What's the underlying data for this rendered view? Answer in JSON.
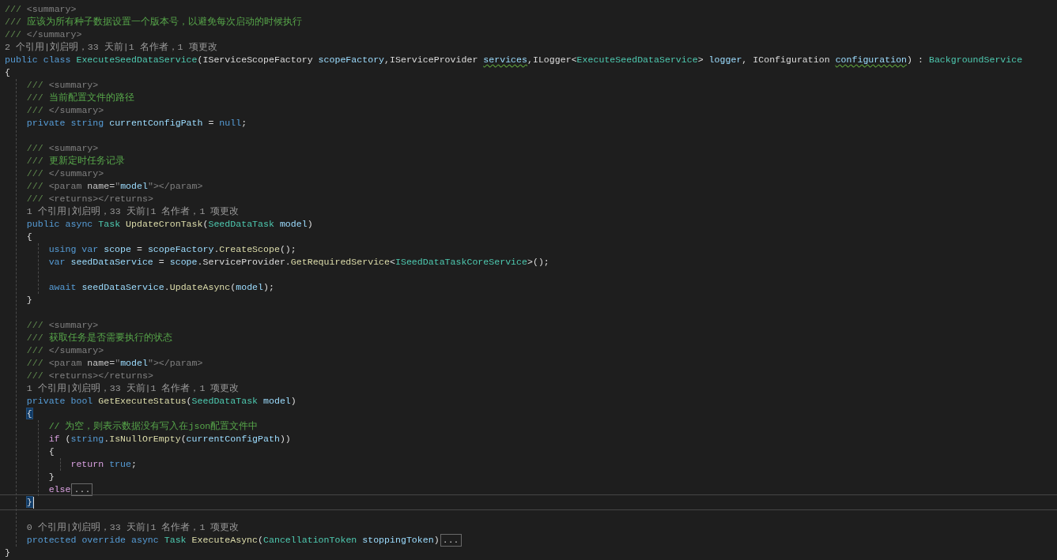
{
  "editor": {
    "lines": [
      {
        "kind": "code",
        "tokens": [
          {
            "text": "/// ",
            "kind": "doc-delim"
          },
          {
            "text": "<summary>",
            "kind": "doc-tag"
          }
        ]
      },
      {
        "kind": "code",
        "tokens": [
          {
            "text": "/// ",
            "kind": "doc-delim"
          },
          {
            "text": "应该为所有种子数据设置一个版本号，以避免每次启动的时候执行",
            "kind": "comment"
          }
        ]
      },
      {
        "kind": "code",
        "tokens": [
          {
            "text": "/// ",
            "kind": "doc-delim"
          },
          {
            "text": "</summary>",
            "kind": "doc-tag"
          }
        ]
      },
      {
        "kind": "codelens",
        "text": "2 个引用|刘启明，33 天前|1 名作者，1 项更改"
      },
      {
        "kind": "code",
        "tokens": [
          {
            "text": "public class ",
            "kind": "keyword"
          },
          {
            "text": "ExecuteSeedDataService",
            "kind": "type"
          },
          {
            "text": "(IServiceScopeFactory ",
            "kind": "plain"
          },
          {
            "text": "scopeFactory",
            "kind": "variable"
          },
          {
            "text": ",IServiceProvider ",
            "kind": "plain"
          },
          {
            "text": "services",
            "kind": "variable-warning"
          },
          {
            "text": ",ILogger<",
            "kind": "plain"
          },
          {
            "text": "ExecuteSeedDataService",
            "kind": "type"
          },
          {
            "text": "> ",
            "kind": "plain"
          },
          {
            "text": "logger",
            "kind": "variable"
          },
          {
            "text": ", IConfiguration ",
            "kind": "plain"
          },
          {
            "text": "configuration",
            "kind": "variable-warning"
          },
          {
            "text": ") : ",
            "kind": "plain"
          },
          {
            "text": "BackgroundService",
            "kind": "type"
          }
        ]
      },
      {
        "kind": "code",
        "tokens": [
          {
            "text": "{",
            "kind": "plain"
          }
        ]
      },
      {
        "kind": "block",
        "children": [
          {
            "kind": "code",
            "tokens": [
              {
                "text": "/// ",
                "kind": "doc-delim"
              },
              {
                "text": "<summary>",
                "kind": "doc-tag"
              }
            ]
          },
          {
            "kind": "code",
            "tokens": [
              {
                "text": "/// ",
                "kind": "doc-delim"
              },
              {
                "text": "当前配置文件的路径",
                "kind": "comment"
              }
            ]
          },
          {
            "kind": "code",
            "tokens": [
              {
                "text": "/// ",
                "kind": "doc-delim"
              },
              {
                "text": "</summary>",
                "kind": "doc-tag"
              }
            ]
          },
          {
            "kind": "code",
            "tokens": [
              {
                "text": "private string ",
                "kind": "keyword"
              },
              {
                "text": "currentConfigPath",
                "kind": "variable"
              },
              {
                "text": " = ",
                "kind": "plain"
              },
              {
                "text": "null",
                "kind": "keyword"
              },
              {
                "text": ";",
                "kind": "plain"
              }
            ]
          },
          {
            "kind": "blank"
          },
          {
            "kind": "code",
            "tokens": [
              {
                "text": "/// ",
                "kind": "doc-delim"
              },
              {
                "text": "<summary>",
                "kind": "doc-tag"
              }
            ]
          },
          {
            "kind": "code",
            "tokens": [
              {
                "text": "/// ",
                "kind": "doc-delim"
              },
              {
                "text": "更新定时任务记录",
                "kind": "comment"
              }
            ]
          },
          {
            "kind": "code",
            "tokens": [
              {
                "text": "/// ",
                "kind": "doc-delim"
              },
              {
                "text": "</summary>",
                "kind": "doc-tag"
              }
            ]
          },
          {
            "kind": "code",
            "tokens": [
              {
                "text": "/// ",
                "kind": "doc-delim"
              },
              {
                "text": "<param ",
                "kind": "doc-tag"
              },
              {
                "text": "name=",
                "kind": "attr"
              },
              {
                "text": "\"",
                "kind": "doc-tag"
              },
              {
                "text": "model",
                "kind": "variable"
              },
              {
                "text": "\"></param>",
                "kind": "doc-tag"
              }
            ]
          },
          {
            "kind": "code",
            "tokens": [
              {
                "text": "/// ",
                "kind": "doc-delim"
              },
              {
                "text": "<returns></returns>",
                "kind": "doc-tag"
              }
            ]
          },
          {
            "kind": "codelens",
            "text": "1 个引用|刘启明，33 天前|1 名作者，1 项更改"
          },
          {
            "kind": "code",
            "tokens": [
              {
                "text": "public async ",
                "kind": "keyword"
              },
              {
                "text": "Task ",
                "kind": "type"
              },
              {
                "text": "UpdateCronTask",
                "kind": "method"
              },
              {
                "text": "(",
                "kind": "plain"
              },
              {
                "text": "SeedDataTask ",
                "kind": "type"
              },
              {
                "text": "model",
                "kind": "variable"
              },
              {
                "text": ")",
                "kind": "plain"
              }
            ]
          },
          {
            "kind": "code",
            "tokens": [
              {
                "text": "{",
                "kind": "plain"
              }
            ]
          },
          {
            "kind": "block",
            "children": [
              {
                "kind": "code",
                "tokens": [
                  {
                    "text": "using var ",
                    "kind": "keyword"
                  },
                  {
                    "text": "scope",
                    "kind": "variable"
                  },
                  {
                    "text": " = ",
                    "kind": "plain"
                  },
                  {
                    "text": "scopeFactory",
                    "kind": "variable"
                  },
                  {
                    "text": ".",
                    "kind": "plain"
                  },
                  {
                    "text": "CreateScope",
                    "kind": "method"
                  },
                  {
                    "text": "();",
                    "kind": "plain"
                  }
                ]
              },
              {
                "kind": "code",
                "tokens": [
                  {
                    "text": "var ",
                    "kind": "keyword"
                  },
                  {
                    "text": "seedDataService",
                    "kind": "variable"
                  },
                  {
                    "text": " = ",
                    "kind": "plain"
                  },
                  {
                    "text": "scope",
                    "kind": "variable"
                  },
                  {
                    "text": ".ServiceProvider.",
                    "kind": "plain"
                  },
                  {
                    "text": "GetRequiredService",
                    "kind": "method"
                  },
                  {
                    "text": "<",
                    "kind": "plain"
                  },
                  {
                    "text": "ISeedDataTaskCoreService",
                    "kind": "type"
                  },
                  {
                    "text": ">();",
                    "kind": "plain"
                  }
                ]
              },
              {
                "kind": "blank"
              },
              {
                "kind": "code",
                "tokens": [
                  {
                    "text": "await ",
                    "kind": "keyword"
                  },
                  {
                    "text": "seedDataService",
                    "kind": "variable"
                  },
                  {
                    "text": ".",
                    "kind": "plain"
                  },
                  {
                    "text": "UpdateAsync",
                    "kind": "method"
                  },
                  {
                    "text": "(",
                    "kind": "plain"
                  },
                  {
                    "text": "model",
                    "kind": "variable"
                  },
                  {
                    "text": ");",
                    "kind": "plain"
                  }
                ]
              }
            ]
          },
          {
            "kind": "code",
            "tokens": [
              {
                "text": "}",
                "kind": "plain"
              }
            ]
          },
          {
            "kind": "blank"
          },
          {
            "kind": "code",
            "tokens": [
              {
                "text": "/// ",
                "kind": "doc-delim"
              },
              {
                "text": "<summary>",
                "kind": "doc-tag"
              }
            ]
          },
          {
            "kind": "code",
            "tokens": [
              {
                "text": "/// ",
                "kind": "doc-delim"
              },
              {
                "text": "获取任务是否需要执行的状态",
                "kind": "comment"
              }
            ]
          },
          {
            "kind": "code",
            "tokens": [
              {
                "text": "/// ",
                "kind": "doc-delim"
              },
              {
                "text": "</summary>",
                "kind": "doc-tag"
              }
            ]
          },
          {
            "kind": "code",
            "tokens": [
              {
                "text": "/// ",
                "kind": "doc-delim"
              },
              {
                "text": "<param ",
                "kind": "doc-tag"
              },
              {
                "text": "name=",
                "kind": "attr"
              },
              {
                "text": "\"",
                "kind": "doc-tag"
              },
              {
                "text": "model",
                "kind": "variable"
              },
              {
                "text": "\"></param>",
                "kind": "doc-tag"
              }
            ]
          },
          {
            "kind": "code",
            "tokens": [
              {
                "text": "/// ",
                "kind": "doc-delim"
              },
              {
                "text": "<returns></returns>",
                "kind": "doc-tag"
              }
            ]
          },
          {
            "kind": "codelens",
            "text": "1 个引用|刘启明，33 天前|1 名作者，1 项更改"
          },
          {
            "kind": "code",
            "tokens": [
              {
                "text": "private bool ",
                "kind": "keyword"
              },
              {
                "text": "GetExecuteStatus",
                "kind": "method"
              },
              {
                "text": "(",
                "kind": "plain"
              },
              {
                "text": "SeedDataTask ",
                "kind": "type"
              },
              {
                "text": "model",
                "kind": "variable"
              },
              {
                "text": ")",
                "kind": "plain"
              }
            ]
          },
          {
            "kind": "code",
            "tokens": [
              {
                "text": "{",
                "kind": "brace-match"
              }
            ]
          },
          {
            "kind": "block",
            "children": [
              {
                "kind": "code",
                "tokens": [
                  {
                    "text": "// 为空，则表示数据没有写入在json配置文件中",
                    "kind": "comment"
                  }
                ]
              },
              {
                "kind": "code",
                "tokens": [
                  {
                    "text": "if ",
                    "kind": "control"
                  },
                  {
                    "text": "(",
                    "kind": "plain"
                  },
                  {
                    "text": "string",
                    "kind": "keyword"
                  },
                  {
                    "text": ".",
                    "kind": "plain"
                  },
                  {
                    "text": "IsNullOrEmpty",
                    "kind": "method"
                  },
                  {
                    "text": "(",
                    "kind": "plain"
                  },
                  {
                    "text": "currentConfigPath",
                    "kind": "variable"
                  },
                  {
                    "text": "))",
                    "kind": "plain"
                  }
                ]
              },
              {
                "kind": "code",
                "tokens": [
                  {
                    "text": "{",
                    "kind": "plain"
                  }
                ]
              },
              {
                "kind": "block",
                "children": [
                  {
                    "kind": "code",
                    "tokens": [
                      {
                        "text": "return ",
                        "kind": "control"
                      },
                      {
                        "text": "true",
                        "kind": "keyword"
                      },
                      {
                        "text": ";",
                        "kind": "plain"
                      }
                    ]
                  }
                ]
              },
              {
                "kind": "code",
                "tokens": [
                  {
                    "text": "}",
                    "kind": "plain"
                  }
                ]
              },
              {
                "kind": "code",
                "tokens": [
                  {
                    "text": "else",
                    "kind": "control"
                  }
                ],
                "fold": "..."
              }
            ]
          },
          {
            "kind": "current-code",
            "tokens": [
              {
                "text": "}",
                "kind": "brace-match"
              }
            ]
          },
          {
            "kind": "blank"
          },
          {
            "kind": "codelens",
            "text": "0 个引用|刘启明，33 天前|1 名作者，1 项更改"
          },
          {
            "kind": "code",
            "tokens": [
              {
                "text": "protected override async ",
                "kind": "keyword"
              },
              {
                "text": "Task ",
                "kind": "type"
              },
              {
                "text": "ExecuteAsync",
                "kind": "method"
              },
              {
                "text": "(",
                "kind": "plain"
              },
              {
                "text": "CancellationToken ",
                "kind": "type"
              },
              {
                "text": "stoppingToken",
                "kind": "variable"
              },
              {
                "text": ")",
                "kind": "plain"
              }
            ],
            "fold": "..."
          }
        ]
      },
      {
        "kind": "code",
        "tokens": [
          {
            "text": "}",
            "kind": "plain"
          }
        ]
      }
    ]
  }
}
